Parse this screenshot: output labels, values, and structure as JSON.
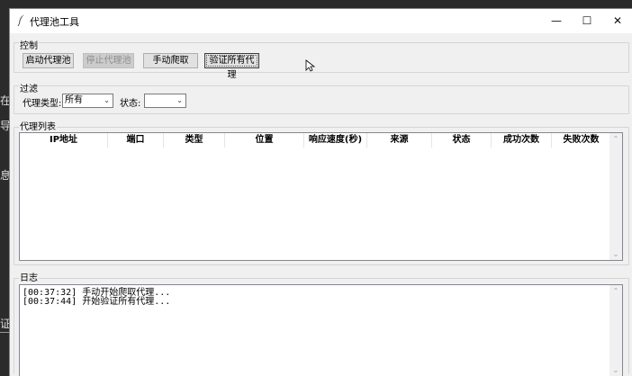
{
  "window": {
    "title": "代理池工具",
    "buttons": {
      "minimize": "—",
      "maximize": "☐",
      "close": "✕"
    }
  },
  "background_fragments": [
    "在",
    "导",
    "息",
    "证"
  ],
  "control": {
    "legend": "控制",
    "start_label": "启动代理池",
    "stop_label": "停止代理池",
    "manual_crawl_label": "手动爬取",
    "verify_all_label": "验证所有代理"
  },
  "filter": {
    "legend": "过滤",
    "type_label": "代理类型:",
    "type_value": "所有",
    "status_label": "状态:",
    "status_value": ""
  },
  "proxy_list": {
    "legend": "代理列表",
    "columns": [
      "IP地址",
      "端口",
      "类型",
      "位置",
      "响应速度(秒)",
      "来源",
      "状态",
      "成功次数",
      "失败次数"
    ],
    "rows": []
  },
  "log": {
    "legend": "日志",
    "lines": [
      "[00:37:32] 手动开始爬取代理...",
      "[00:37:44] 开始验证所有代理..."
    ]
  },
  "colors": {
    "window_bg": "#f0f0f0",
    "titlebar_bg": "#ffffff",
    "desktop_bg": "#2b2b2b",
    "button_bg": "#e1e1e1"
  }
}
